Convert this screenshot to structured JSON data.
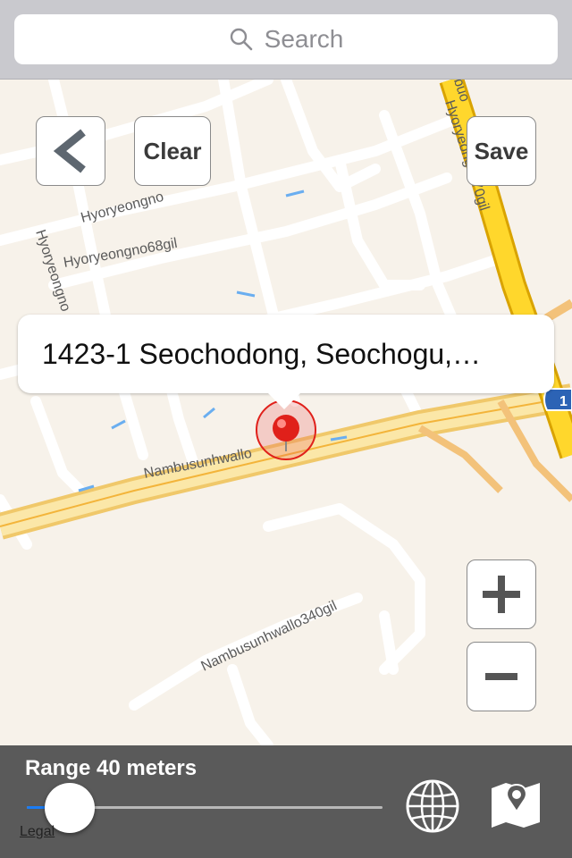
{
  "search": {
    "placeholder": "Search",
    "icon": "search-icon"
  },
  "toolbar": {
    "back_icon": "chevron-left-icon",
    "clear_label": "Clear",
    "save_label": "Save",
    "zoom_in_icon": "plus-icon",
    "zoom_out_icon": "minus-icon"
  },
  "map": {
    "callout_text": "1423-1 Seochodong, Seochogu,…",
    "street_labels": [
      "Hyoryeongno",
      "Hyoryeongno68gil",
      "Hyoryeongno",
      "Hyoryeongno70gil",
      "Nambusunhwallo",
      "Nambusunhwallo340gil",
      "gbuo"
    ],
    "highway_shield": "1",
    "pin_color": "#e0201a",
    "accent_color": "#f5c518"
  },
  "bottom": {
    "range_label": "Range 40 meters",
    "slider_value_fraction": 0.12,
    "legal_label": "Legal",
    "globe_icon": "globe-icon",
    "map_icon": "map-pin-icon"
  }
}
